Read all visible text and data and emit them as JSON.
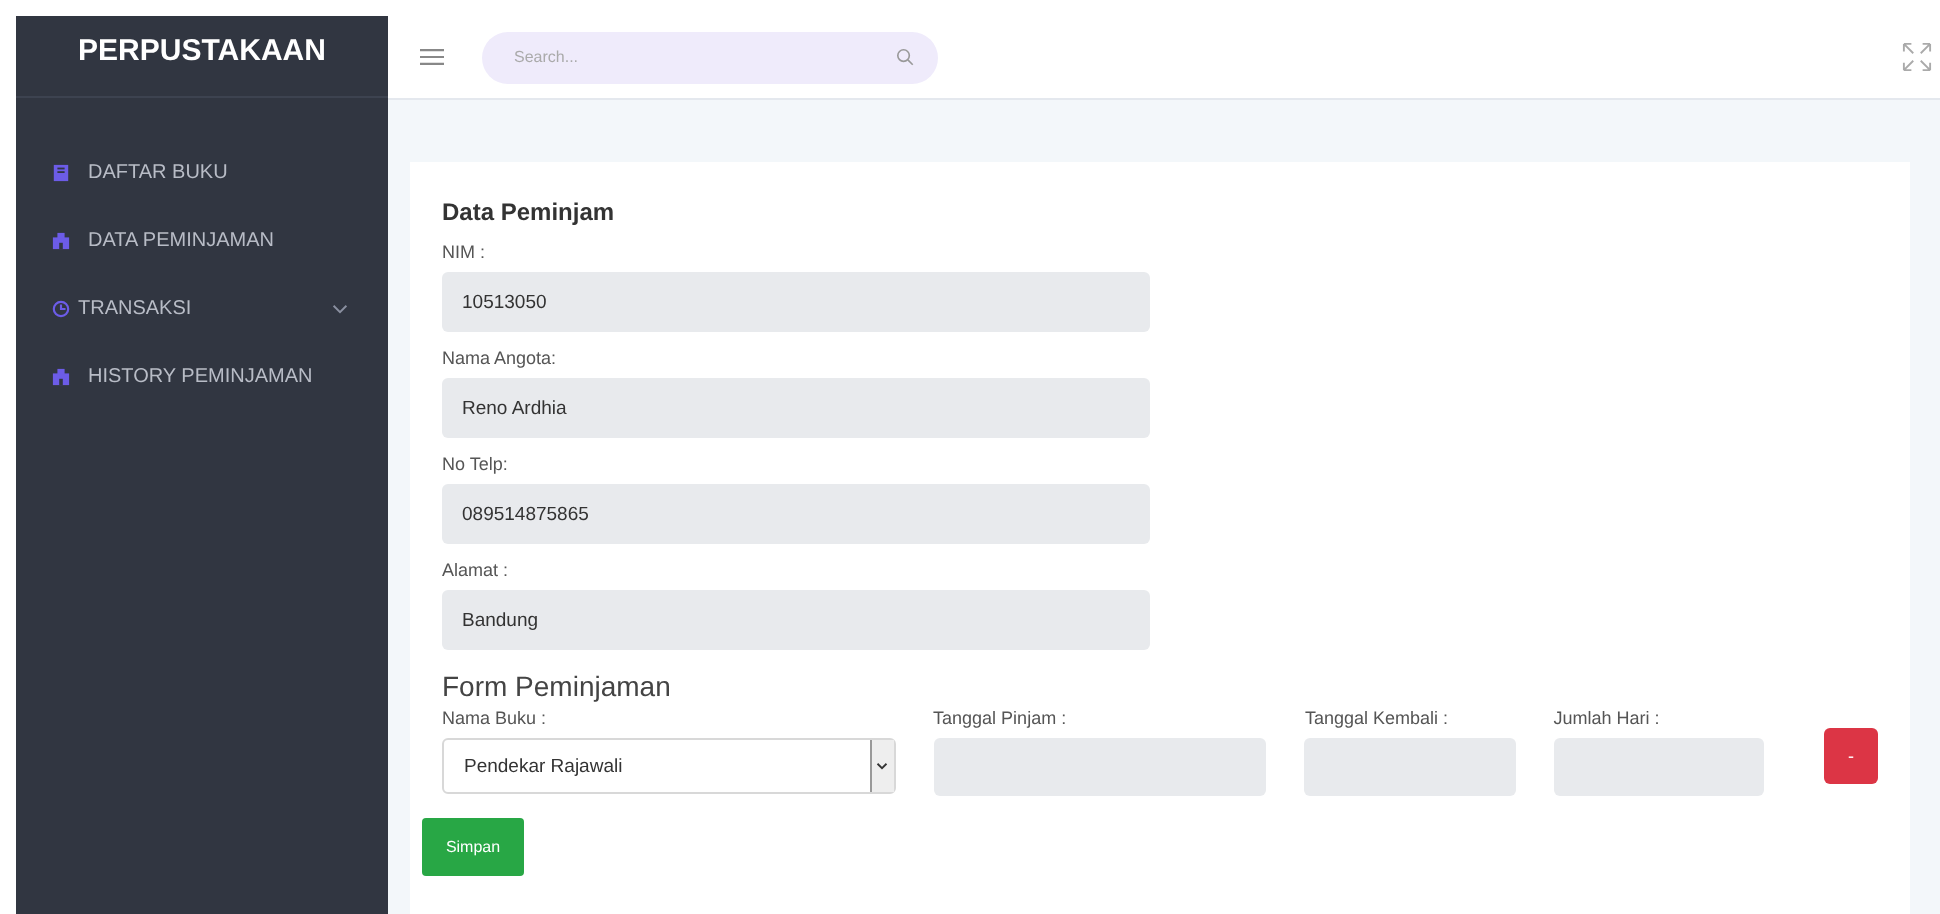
{
  "sidebar": {
    "brand": "PERPUSTAKAAN",
    "items": [
      {
        "label": "DAFTAR BUKU",
        "has_submenu": false
      },
      {
        "label": "DATA PEMINJAMAN",
        "has_submenu": false
      },
      {
        "label": "TRANSAKSI",
        "has_submenu": true
      },
      {
        "label": "HISTORY PEMINJAMAN",
        "has_submenu": false
      }
    ]
  },
  "header": {
    "search": {
      "placeholder": "Search..."
    }
  },
  "borrower": {
    "title": "Data Peminjam",
    "fields": [
      {
        "label": "NIM :",
        "value": "10513050"
      },
      {
        "label": "Nama Angota:",
        "value": "Reno Ardhia"
      },
      {
        "label": "No Telp:",
        "value": "089514875865"
      },
      {
        "label": "Alamat :",
        "value": "Bandung"
      }
    ]
  },
  "loan_form": {
    "title": "Form Peminjaman",
    "book": {
      "label": "Nama Buku :",
      "value": "Pendekar Rajawali"
    },
    "fields": [
      {
        "label": "Tanggal Pinjam :"
      },
      {
        "label": "Tanggal Kembali :"
      },
      {
        "label": "Jumlah Hari :"
      }
    ],
    "remove_button": "-",
    "save_button": "Simpan"
  }
}
